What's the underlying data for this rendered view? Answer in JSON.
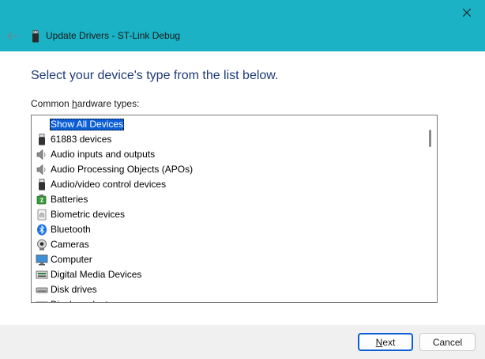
{
  "window": {
    "title": "Update Drivers - ST-Link Debug",
    "title_bar_color": "#1ab2c4",
    "close_icon": "close-icon",
    "back_icon": "back-arrow-icon"
  },
  "heading": "Select your device's type from the list below.",
  "list_label": {
    "before": "Common ",
    "accel": "h",
    "after": "ardware types:"
  },
  "hardware_types": [
    {
      "label": "Show All Devices",
      "icon": "none",
      "selected": true
    },
    {
      "label": "61883 devices",
      "icon": "usb-plug-icon"
    },
    {
      "label": "Audio inputs and outputs",
      "icon": "speaker-icon"
    },
    {
      "label": "Audio Processing Objects (APOs)",
      "icon": "speaker-icon"
    },
    {
      "label": "Audio/video control devices",
      "icon": "usb-plug-icon"
    },
    {
      "label": "Batteries",
      "icon": "battery-icon"
    },
    {
      "label": "Biometric devices",
      "icon": "fingerprint-icon"
    },
    {
      "label": "Bluetooth",
      "icon": "bluetooth-icon"
    },
    {
      "label": "Cameras",
      "icon": "camera-icon"
    },
    {
      "label": "Computer",
      "icon": "monitor-icon"
    },
    {
      "label": "Digital Media Devices",
      "icon": "media-device-icon"
    },
    {
      "label": "Disk drives",
      "icon": "disk-drive-icon"
    },
    {
      "label": "Display adapters",
      "icon": "display-adapter-icon"
    }
  ],
  "buttons": {
    "next_accel": "N",
    "next_rest": "ext",
    "cancel": "Cancel"
  },
  "colors": {
    "accent": "#0b5ed6",
    "heading": "#1e3a78"
  }
}
